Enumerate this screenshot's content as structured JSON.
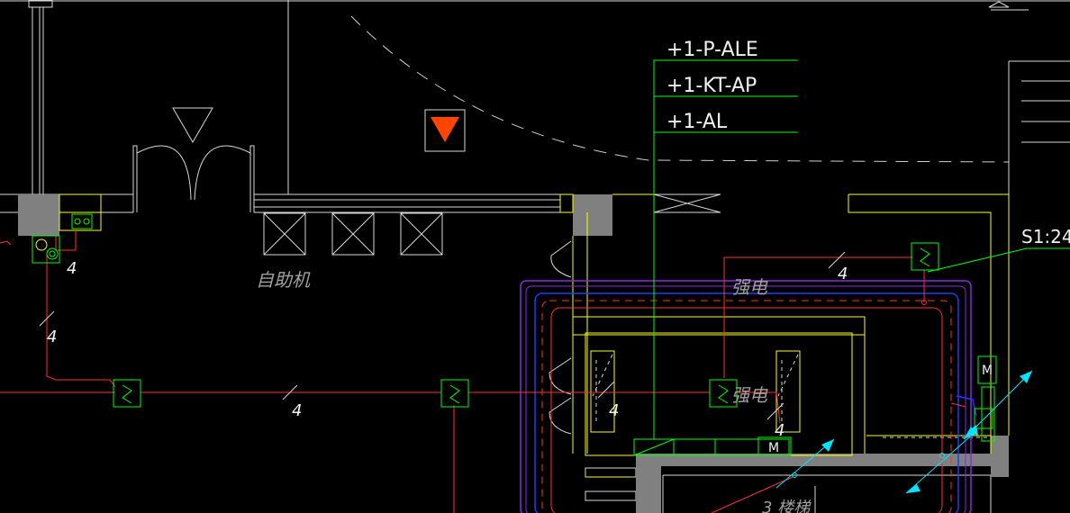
{
  "drawing": {
    "labels": {
      "panel_ale": "+1-P-ALE",
      "panel_ktap": "+1-KT-AP",
      "panel_al": "+1-AL",
      "callout_s": "S1:24",
      "atm": "自助机",
      "strong_power_top": "强电",
      "strong_power_mid": "强电",
      "stairs": "3  楼梯"
    },
    "wire_counts": {
      "left_box": "4",
      "left_vertical": "4",
      "bottom_run": "4",
      "top_run": "4",
      "shaft_left": "4",
      "shaft_right": "4"
    },
    "symbols": {
      "motor": "M",
      "motor_side": "M"
    },
    "colors": {
      "background": "#000000",
      "wall": "#ffffff",
      "outline": "#ffff00",
      "wiring": "#ff3030",
      "panel_lines": "#00ff00",
      "cable_tray_outer": "#8a2be2",
      "cable_tray_inner": "#1e3cff",
      "dimension": "#00e5ff",
      "fill": "#808080",
      "marker": "#ff4500"
    }
  }
}
